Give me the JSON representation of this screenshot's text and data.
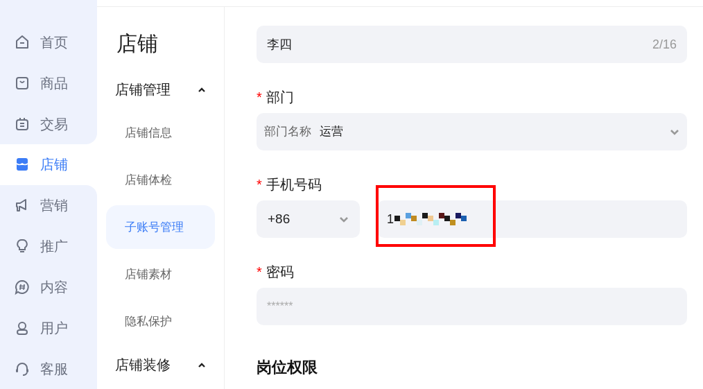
{
  "sidebar": {
    "items": [
      {
        "label": "首页",
        "selected": false
      },
      {
        "label": "商品",
        "selected": false
      },
      {
        "label": "交易",
        "selected": false
      },
      {
        "label": "店铺",
        "selected": true
      },
      {
        "label": "营销",
        "selected": false
      },
      {
        "label": "推广",
        "selected": false
      },
      {
        "label": "内容",
        "selected": false
      },
      {
        "label": "用户",
        "selected": false
      },
      {
        "label": "客服",
        "selected": false
      }
    ]
  },
  "submenu": {
    "title": "店铺",
    "groups": [
      {
        "label": "店铺管理",
        "expanded": true,
        "children": [
          {
            "label": "店铺信息",
            "selected": false
          },
          {
            "label": "店铺体检",
            "selected": false
          },
          {
            "label": "子账号管理",
            "selected": true
          },
          {
            "label": "店铺素材",
            "selected": false
          },
          {
            "label": "隐私保护",
            "selected": false
          }
        ]
      },
      {
        "label": "店铺装修",
        "expanded": true
      }
    ]
  },
  "form": {
    "fields": [
      {
        "kind": "text",
        "value": "李四",
        "counter": "2/16"
      },
      {
        "kind": "select",
        "label": "部门",
        "required_mark": "*",
        "prefix": "部门名称",
        "value": "运营"
      },
      {
        "kind": "phone",
        "label": "手机号码",
        "required_mark": "*",
        "country_code": "+86",
        "value": "1",
        "redacted": true,
        "highlighted": true
      },
      {
        "kind": "password",
        "label": "密码",
        "required_mark": "*",
        "placeholder": "******"
      }
    ],
    "section_title": "岗位权限"
  }
}
